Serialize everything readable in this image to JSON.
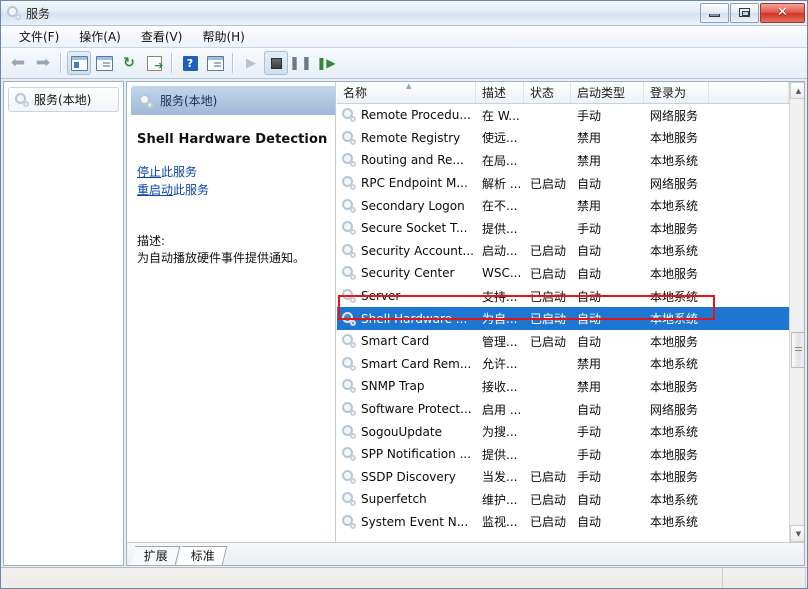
{
  "window": {
    "title": "服务",
    "title_icon": "services-cog-icon",
    "minimize_label": "最小化",
    "maximize_label": "还原",
    "close_label": "关闭",
    "close_glyph": "✕"
  },
  "menubar": {
    "items": [
      {
        "label": "文件(F)",
        "name": "menu-file"
      },
      {
        "label": "操作(A)",
        "name": "menu-action"
      },
      {
        "label": "查看(V)",
        "name": "menu-view"
      },
      {
        "label": "帮助(H)",
        "name": "menu-help"
      }
    ]
  },
  "toolbar": {
    "buttons": [
      {
        "name": "back-button",
        "icon": "arrow-left-icon",
        "glyph": "⬅",
        "enabled": false
      },
      {
        "name": "forward-button",
        "icon": "arrow-right-icon",
        "glyph": "➡",
        "enabled": false
      },
      {
        "name": "show-hide-tree-button",
        "icon": "tree-panel-icon",
        "glyph": "",
        "enabled": true
      },
      {
        "name": "properties-button",
        "icon": "properties-icon",
        "glyph": "",
        "enabled": true
      },
      {
        "name": "refresh-button",
        "icon": "refresh-icon",
        "glyph": "↻",
        "enabled": true
      },
      {
        "name": "export-list-button",
        "icon": "export-list-icon",
        "glyph": "",
        "enabled": true
      },
      {
        "name": "help-button",
        "icon": "help-icon",
        "glyph": "?",
        "enabled": true
      },
      {
        "name": "show-action-pane-button",
        "icon": "action-pane-icon",
        "glyph": "",
        "enabled": true
      },
      {
        "name": "start-service-button",
        "icon": "play-icon",
        "glyph": "▶",
        "enabled": false
      },
      {
        "name": "stop-service-button",
        "icon": "stop-icon",
        "glyph": "■",
        "enabled": true
      },
      {
        "name": "pause-service-button",
        "icon": "pause-icon",
        "glyph": "❙❙",
        "enabled": true
      },
      {
        "name": "restart-service-button",
        "icon": "restart-icon",
        "glyph": "❙▶",
        "enabled": true
      }
    ]
  },
  "sidebar": {
    "items": [
      {
        "label": "服务(本地)",
        "icon": "services-cog-icon",
        "name": "tree-item-services-local"
      }
    ]
  },
  "detail": {
    "header": "服务(本地)",
    "header_icon": "services-cog-icon",
    "service_title": "Shell Hardware Detection",
    "links": [
      {
        "underlined": "停止",
        "rest": "此服务",
        "name": "stop-service-link"
      },
      {
        "underlined": "重启动",
        "rest": "此服务",
        "name": "restart-service-link"
      }
    ],
    "description_label": "描述:",
    "description": "为自动播放硬件事件提供通知。"
  },
  "list": {
    "columns": [
      {
        "label": "名称",
        "width": 139,
        "sorted": true,
        "name": "column-name"
      },
      {
        "label": "描述",
        "width": 48,
        "sorted": false,
        "name": "column-description"
      },
      {
        "label": "状态",
        "width": 47,
        "sorted": false,
        "name": "column-status"
      },
      {
        "label": "启动类型",
        "width": 73,
        "sorted": false,
        "name": "column-startup-type"
      },
      {
        "label": "登录为",
        "width": 65,
        "sorted": false,
        "name": "column-log-on-as"
      },
      {
        "label": "",
        "width": 80,
        "sorted": false,
        "name": "column-extra"
      }
    ],
    "rows": [
      {
        "name": "Remote Procedu...",
        "description": "在 W...",
        "status": "",
        "startup": "手动",
        "logon": "网络服务",
        "selected": false
      },
      {
        "name": "Remote Registry",
        "description": "使远...",
        "status": "",
        "startup": "禁用",
        "logon": "本地服务",
        "selected": false
      },
      {
        "name": "Routing and Re...",
        "description": "在局...",
        "status": "",
        "startup": "禁用",
        "logon": "本地系统",
        "selected": false
      },
      {
        "name": "RPC Endpoint M...",
        "description": "解析 ...",
        "status": "已启动",
        "startup": "自动",
        "logon": "网络服务",
        "selected": false
      },
      {
        "name": "Secondary Logon",
        "description": "在不...",
        "status": "",
        "startup": "禁用",
        "logon": "本地系统",
        "selected": false
      },
      {
        "name": "Secure Socket T...",
        "description": "提供...",
        "status": "",
        "startup": "手动",
        "logon": "本地服务",
        "selected": false
      },
      {
        "name": "Security Account...",
        "description": "启动...",
        "status": "已启动",
        "startup": "自动",
        "logon": "本地系统",
        "selected": false
      },
      {
        "name": "Security Center",
        "description": "WSC...",
        "status": "已启动",
        "startup": "自动",
        "logon": "本地服务",
        "selected": false
      },
      {
        "name": "Server",
        "description": "支持...",
        "status": "已启动",
        "startup": "自动",
        "logon": "本地系统",
        "selected": false
      },
      {
        "name": "Shell Hardware ...",
        "description": "为自...",
        "status": "已启动",
        "startup": "自动",
        "logon": "本地系统",
        "selected": true
      },
      {
        "name": "Smart Card",
        "description": "管理...",
        "status": "已启动",
        "startup": "自动",
        "logon": "本地服务",
        "selected": false
      },
      {
        "name": "Smart Card Rem...",
        "description": "允许...",
        "status": "",
        "startup": "禁用",
        "logon": "本地系统",
        "selected": false
      },
      {
        "name": "SNMP Trap",
        "description": "接收...",
        "status": "",
        "startup": "禁用",
        "logon": "本地服务",
        "selected": false
      },
      {
        "name": "Software Protect...",
        "description": "启用 ...",
        "status": "",
        "startup": "自动",
        "logon": "网络服务",
        "selected": false
      },
      {
        "name": "SogouUpdate",
        "description": "为搜...",
        "status": "",
        "startup": "手动",
        "logon": "本地系统",
        "selected": false
      },
      {
        "name": "SPP Notification ...",
        "description": "提供...",
        "status": "",
        "startup": "手动",
        "logon": "本地服务",
        "selected": false
      },
      {
        "name": "SSDP Discovery",
        "description": "当发...",
        "status": "已启动",
        "startup": "手动",
        "logon": "本地服务",
        "selected": false
      },
      {
        "name": "Superfetch",
        "description": "维护...",
        "status": "已启动",
        "startup": "自动",
        "logon": "本地系统",
        "selected": false
      },
      {
        "name": "System Event N...",
        "description": "监视...",
        "status": "已启动",
        "startup": "自动",
        "logon": "本地系统",
        "selected": false
      }
    ],
    "scrollbar": {
      "up_glyph": "▲",
      "down_glyph": "▼"
    }
  },
  "tabs": [
    {
      "label": "扩展",
      "active": false,
      "name": "tab-extended"
    },
    {
      "label": "标准",
      "active": true,
      "name": "tab-standard"
    }
  ],
  "statusbar": {
    "text": ""
  },
  "colors": {
    "selection_blue": "#1d76d1",
    "annotation_red": "#e81313",
    "link_blue": "#0b44a8",
    "header_band": "#9fb9d8"
  }
}
